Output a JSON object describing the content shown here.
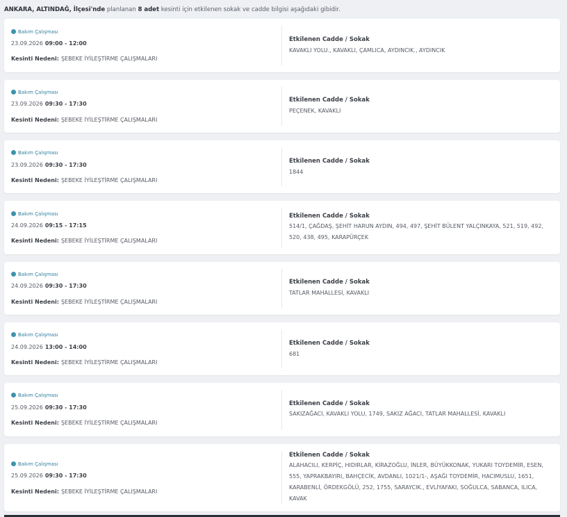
{
  "summary": {
    "location": "ANKARA, ALTINDAĞ, İlçesi'nde",
    "mid": "planlanan",
    "count": "8 adet",
    "rest": "kesinti için etkilenen sokak ve cadde bilgisi aşağıdaki gibidir."
  },
  "labels": {
    "reason_label": "Kesinti Nedeni:",
    "street_title": "Etkilenen Cadde / Sokak"
  },
  "outages": [
    {
      "type": "Bakım Çalışması",
      "date": "23.09.2026",
      "time": "09:00 - 12:00",
      "reason": "ŞEBEKE İYİLEŞTİRME ÇALIŞMALARI",
      "streets": "KAVAKLI YOLU., KAVAKLI, ÇAMLICA, AYDINCIK., AYDINCIK"
    },
    {
      "type": "Bakım Çalışması",
      "date": "23.09.2026",
      "time": "09:30 - 17:30",
      "reason": "ŞEBEKE İYİLEŞTİRME ÇALIŞMALARI",
      "streets": "PEÇENEK, KAVAKLI"
    },
    {
      "type": "Bakım Çalışması",
      "date": "23.09.2026",
      "time": "09:30 - 17:30",
      "reason": "ŞEBEKE İYİLEŞTİRME ÇALIŞMALARI",
      "streets": "1844"
    },
    {
      "type": "Bakım Çalışması",
      "date": "24.09.2026",
      "time": "09:15 - 17:15",
      "reason": "ŞEBEKE İYİLEŞTİRME ÇALIŞMALARI",
      "streets": "514/1, ÇAĞDAŞ, ŞEHİT HARUN AYDIN, 494, 497, ŞEHİT BÜLENT YALÇINKAYA, 521, 519, 492, 520, 438, 495, KARAPÜRÇEK"
    },
    {
      "type": "Bakım Çalışması",
      "date": "24.09.2026",
      "time": "09:30 - 17:30",
      "reason": "ŞEBEKE İYİLEŞTİRME ÇALIŞMALARI",
      "streets": "TATLAR MAHALLESİ, KAVAKLI"
    },
    {
      "type": "Bakım Çalışması",
      "date": "24.09.2026",
      "time": "13:00 - 14:00",
      "reason": "ŞEBEKE İYİLEŞTİRME ÇALIŞMALARI",
      "streets": "681"
    },
    {
      "type": "Bakım Çalışması",
      "date": "25.09.2026",
      "time": "09:30 - 17:30",
      "reason": "ŞEBEKE İYİLEŞTİRME ÇALIŞMALARI",
      "streets": "SAKIZAĞACI, KAVAKLI YOLU, 1749, SAKIZ AĞACI, TATLAR MAHALLESİ, KAVAKLI"
    },
    {
      "type": "Bakım Çalışması",
      "date": "25.09.2026",
      "time": "09:30 - 17:30",
      "reason": "ŞEBEKE İYİLEŞTİRME ÇALIŞMALARI",
      "streets": "ALAHACILI, KERPİÇ, HIDIRLAR, KİRAZOĞLU, İNLER, BÜYÜKKONAK, YUKARI TOYDEMİR, ESEN, 555, YAPRAKBAYIRI, BAHÇECİK, AVDANLI, 1021/1-, AŞAĞI TOYDEMİR, HACIMUSLU, 1651, KARABENLİ, ÖRDEKGÖLÜ, 252, 1755, SARAYCIK., EVLİYAFAKI, SOĞULCA, SABANCA, ILICA, KAVAK"
    }
  ]
}
